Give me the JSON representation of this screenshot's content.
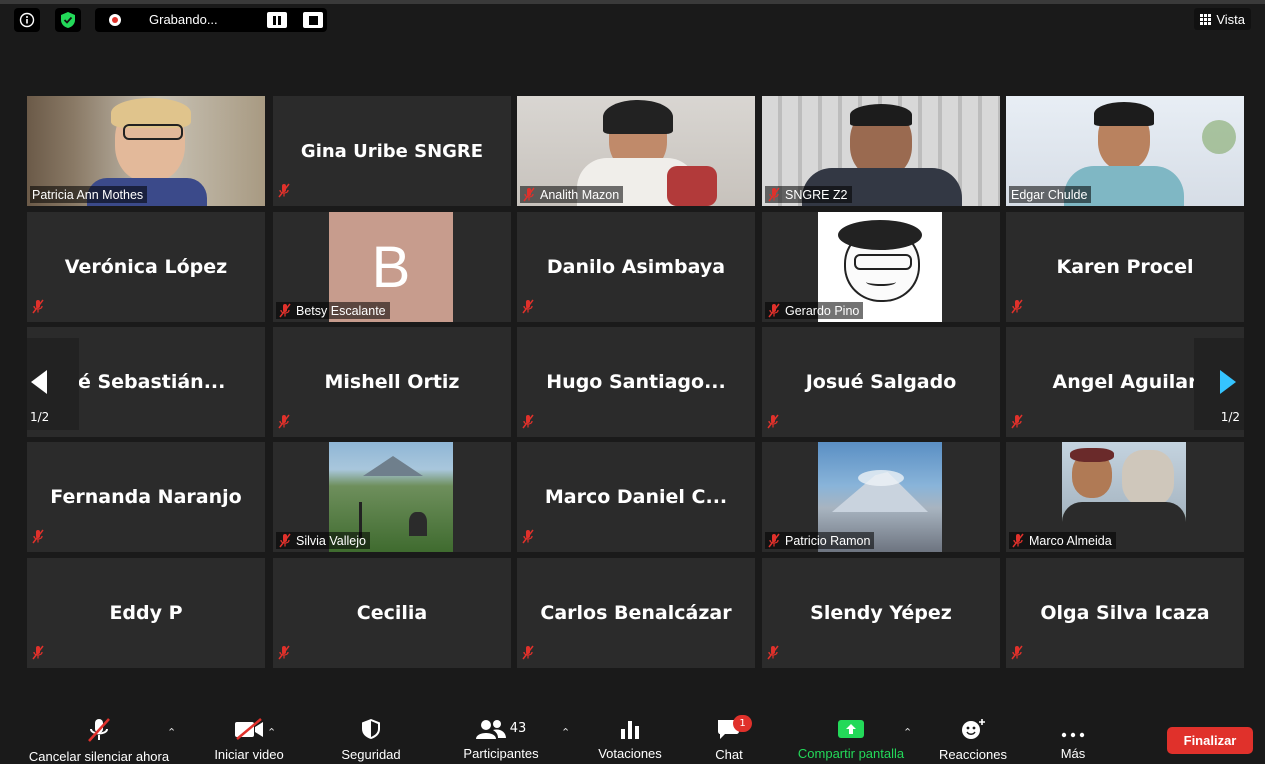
{
  "meeting": {
    "recording_label": "Grabando...",
    "view_label": "Vista",
    "page_indicator_left": "1/2",
    "page_indicator_right": "1/2"
  },
  "tiles": [
    {
      "name": "Patricia Ann Mothes",
      "kind": "video",
      "active": true
    },
    {
      "name": "Gina Uribe SNGRE",
      "kind": "name"
    },
    {
      "name": "Analith Mazon",
      "kind": "video"
    },
    {
      "name": "SNGRE Z2",
      "kind": "video"
    },
    {
      "name": "Edgar Chulde",
      "kind": "video"
    },
    {
      "name": "Verónica López",
      "kind": "name"
    },
    {
      "name": "Betsy Escalante",
      "kind": "avatar",
      "avatar_letter": "B"
    },
    {
      "name": "Danilo Asimbaya",
      "kind": "name"
    },
    {
      "name": "Gerardo Pino",
      "kind": "picture"
    },
    {
      "name": "Karen Procel",
      "kind": "name"
    },
    {
      "name": "sé Sebastián...",
      "kind": "name"
    },
    {
      "name": "Mishell Ortiz",
      "kind": "name"
    },
    {
      "name": "Hugo Santiago...",
      "kind": "name"
    },
    {
      "name": "Josué Salgado",
      "kind": "name"
    },
    {
      "name": "Angel Aguilar",
      "kind": "name"
    },
    {
      "name": "Fernanda Naranjo",
      "kind": "name"
    },
    {
      "name": "Silvia Vallejo",
      "kind": "picture"
    },
    {
      "name": "Marco Daniel C...",
      "kind": "name"
    },
    {
      "name": "Patricio Ramon",
      "kind": "picture"
    },
    {
      "name": "Marco Almeida",
      "kind": "picture"
    },
    {
      "name": "Eddy P",
      "kind": "name"
    },
    {
      "name": "Cecilia",
      "kind": "name"
    },
    {
      "name": "Carlos Benalcázar",
      "kind": "name"
    },
    {
      "name": "Slendy Yépez",
      "kind": "name"
    },
    {
      "name": "Olga Silva Icaza",
      "kind": "name"
    }
  ],
  "toolbar": {
    "mute_label": "Cancelar silenciar ahora",
    "video_label": "Iniciar video",
    "security_label": "Seguridad",
    "participants_label": "Participantes",
    "participants_count": "43",
    "polls_label": "Votaciones",
    "chat_label": "Chat",
    "chat_badge": "1",
    "share_label": "Compartir pantalla",
    "reactions_label": "Reacciones",
    "more_label": "Más",
    "end_label": "Finalizar"
  },
  "colors": {
    "background": "#1a1a1a",
    "tile": "#2b2b2b",
    "active_border": "#d8ed5a",
    "share_green": "#23d959",
    "end_red": "#e0312b",
    "nav_arrow": "#35c4ff"
  },
  "icons": [
    "info-icon",
    "shield-check-icon",
    "record-icon",
    "pause-icon",
    "stop-icon",
    "grid-icon",
    "microphone-muted-icon",
    "camera-off-icon",
    "shield-icon",
    "participants-icon",
    "poll-icon",
    "chat-icon",
    "share-screen-icon",
    "reaction-icon",
    "more-icon",
    "chevron-left-icon",
    "chevron-right-icon"
  ]
}
